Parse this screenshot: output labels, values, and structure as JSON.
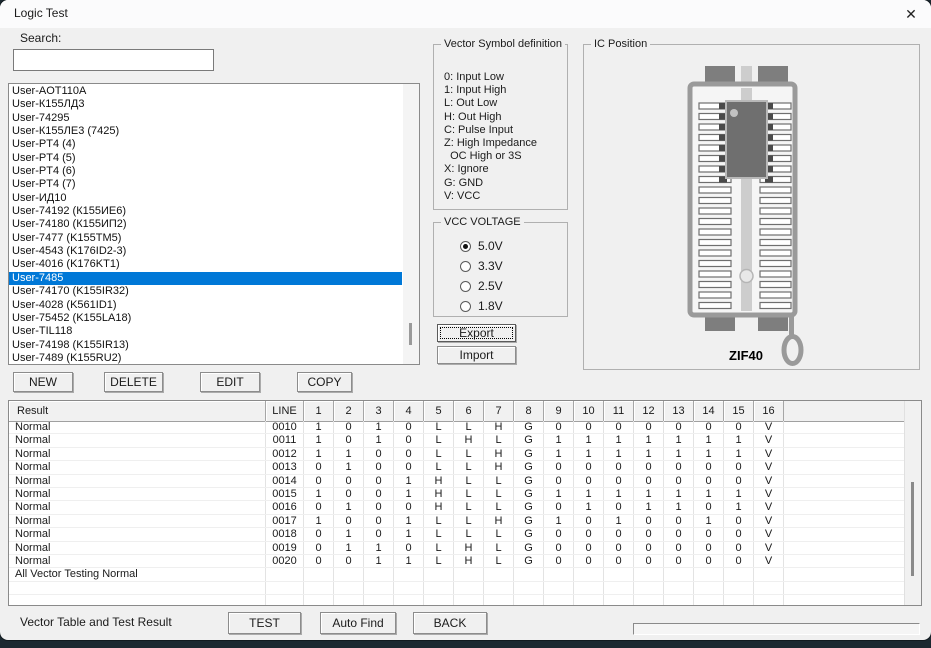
{
  "window": {
    "title": "Logic Test",
    "close_glyph": "✕"
  },
  "colors": {
    "selection_blue": "#0078d7",
    "titlebar_bg": "#fbfbfc",
    "dialog_bg": "#f0f0f0",
    "socket_gray": "#9a9a9a",
    "chip_gray": "#6f6f6f"
  },
  "search": {
    "label": "Search:",
    "value": "",
    "placeholder": ""
  },
  "chip_list": {
    "selected_index": 14,
    "items": [
      "User-AOT110A",
      "User-К155ЛД3",
      "User-74295",
      "User-К155ЛЕ3 (7425)",
      "User-PT4 (4)",
      "User-PT4 (5)",
      "User-PT4 (6)",
      "User-PT4 (7)",
      "User-ИД10",
      "User-74192 (К155ИЕ6)",
      "User-74180 (К155ИП2)",
      "User-7477 (K155TM5)",
      "User-4543 (K176ID2-3)",
      "User-4016 (K176KT1)",
      "User-7485",
      "User-74170 (K155IR32)",
      "User-4028 (K561ID1)",
      "User-75452 (K155LA18)",
      "User-TIL118",
      "User-74198 (K155IR13)",
      "User-7489 (K155RU2)"
    ]
  },
  "actions": {
    "new": "NEW",
    "delete": "DELETE",
    "edit": "EDIT",
    "copy": "COPY"
  },
  "vector_symbols": {
    "title": "Vector Symbol definition",
    "lines": [
      "0: Input Low",
      "1: Input High",
      "L: Out Low",
      "H: Out High",
      "C: Pulse Input",
      "Z: High Impedance",
      "  OC High or 3S",
      "X: Ignore",
      "G: GND",
      "V: VCC"
    ]
  },
  "vcc": {
    "title": "VCC VOLTAGE",
    "selected_index": 0,
    "options": [
      "5.0V",
      "3.3V",
      "2.5V",
      "1.8V"
    ]
  },
  "io_buttons": {
    "export": "Export",
    "import": "Import"
  },
  "ic_position": {
    "title": "IC Position",
    "socket_label": "ZIF40"
  },
  "table": {
    "headers": [
      "Result",
      "LINE",
      "1",
      "2",
      "3",
      "4",
      "5",
      "6",
      "7",
      "8",
      "9",
      "10",
      "11",
      "12",
      "13",
      "14",
      "15",
      "16"
    ],
    "rows": [
      {
        "result": "Normal",
        "line": "0010",
        "pins": [
          "1",
          "0",
          "1",
          "0",
          "L",
          "L",
          "H",
          "G",
          "0",
          "0",
          "0",
          "0",
          "0",
          "0",
          "0",
          "V"
        ]
      },
      {
        "result": "Normal",
        "line": "0011",
        "pins": [
          "1",
          "0",
          "1",
          "0",
          "L",
          "H",
          "L",
          "G",
          "1",
          "1",
          "1",
          "1",
          "1",
          "1",
          "1",
          "V"
        ]
      },
      {
        "result": "Normal",
        "line": "0012",
        "pins": [
          "1",
          "1",
          "0",
          "0",
          "L",
          "L",
          "H",
          "G",
          "1",
          "1",
          "1",
          "1",
          "1",
          "1",
          "1",
          "V"
        ]
      },
      {
        "result": "Normal",
        "line": "0013",
        "pins": [
          "0",
          "1",
          "0",
          "0",
          "L",
          "L",
          "H",
          "G",
          "0",
          "0",
          "0",
          "0",
          "0",
          "0",
          "0",
          "V"
        ]
      },
      {
        "result": "Normal",
        "line": "0014",
        "pins": [
          "0",
          "0",
          "0",
          "1",
          "H",
          "L",
          "L",
          "G",
          "0",
          "0",
          "0",
          "0",
          "0",
          "0",
          "0",
          "V"
        ]
      },
      {
        "result": "Normal",
        "line": "0015",
        "pins": [
          "1",
          "0",
          "0",
          "1",
          "H",
          "L",
          "L",
          "G",
          "1",
          "1",
          "1",
          "1",
          "1",
          "1",
          "1",
          "V"
        ]
      },
      {
        "result": "Normal",
        "line": "0016",
        "pins": [
          "0",
          "1",
          "0",
          "0",
          "H",
          "L",
          "L",
          "G",
          "0",
          "1",
          "0",
          "1",
          "1",
          "0",
          "1",
          "V"
        ]
      },
      {
        "result": "Normal",
        "line": "0017",
        "pins": [
          "1",
          "0",
          "0",
          "1",
          "L",
          "L",
          "H",
          "G",
          "1",
          "0",
          "1",
          "0",
          "0",
          "1",
          "0",
          "V"
        ]
      },
      {
        "result": "Normal",
        "line": "0018",
        "pins": [
          "0",
          "1",
          "0",
          "1",
          "L",
          "L",
          "L",
          "G",
          "0",
          "0",
          "0",
          "0",
          "0",
          "0",
          "0",
          "V"
        ]
      },
      {
        "result": "Normal",
        "line": "0019",
        "pins": [
          "0",
          "1",
          "1",
          "0",
          "L",
          "H",
          "L",
          "G",
          "0",
          "0",
          "0",
          "0",
          "0",
          "0",
          "0",
          "V"
        ]
      },
      {
        "result": "Normal",
        "line": "0020",
        "pins": [
          "0",
          "0",
          "1",
          "1",
          "L",
          "H",
          "L",
          "G",
          "0",
          "0",
          "0",
          "0",
          "0",
          "0",
          "0",
          "V"
        ]
      }
    ],
    "summary": "All Vector Testing Normal"
  },
  "footer": {
    "label": "Vector Table and Test Result",
    "test": "TEST",
    "auto_find": "Auto Find",
    "back": "BACK"
  }
}
